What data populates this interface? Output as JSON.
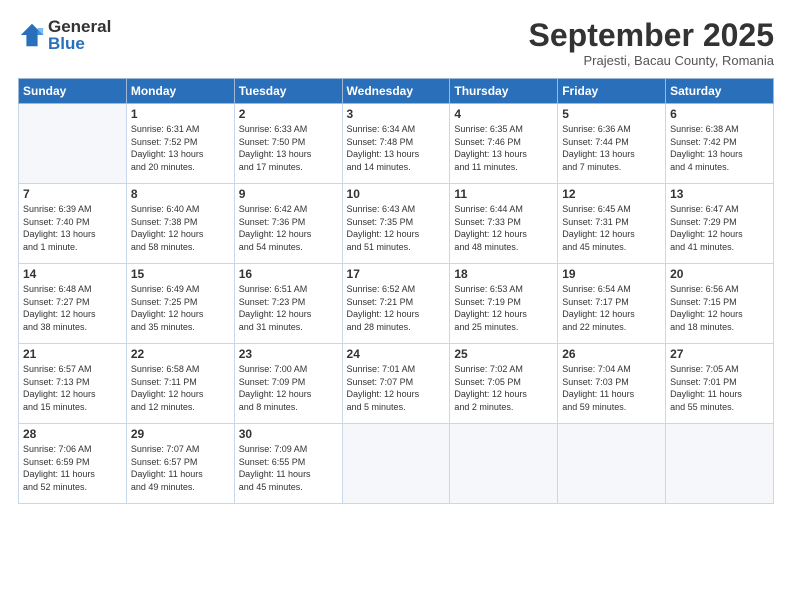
{
  "header": {
    "logo_general": "General",
    "logo_blue": "Blue",
    "month_title": "September 2025",
    "location": "Prajesti, Bacau County, Romania"
  },
  "weekdays": [
    "Sunday",
    "Monday",
    "Tuesday",
    "Wednesday",
    "Thursday",
    "Friday",
    "Saturday"
  ],
  "weeks": [
    [
      {
        "day": "",
        "info": ""
      },
      {
        "day": "1",
        "info": "Sunrise: 6:31 AM\nSunset: 7:52 PM\nDaylight: 13 hours\nand 20 minutes."
      },
      {
        "day": "2",
        "info": "Sunrise: 6:33 AM\nSunset: 7:50 PM\nDaylight: 13 hours\nand 17 minutes."
      },
      {
        "day": "3",
        "info": "Sunrise: 6:34 AM\nSunset: 7:48 PM\nDaylight: 13 hours\nand 14 minutes."
      },
      {
        "day": "4",
        "info": "Sunrise: 6:35 AM\nSunset: 7:46 PM\nDaylight: 13 hours\nand 11 minutes."
      },
      {
        "day": "5",
        "info": "Sunrise: 6:36 AM\nSunset: 7:44 PM\nDaylight: 13 hours\nand 7 minutes."
      },
      {
        "day": "6",
        "info": "Sunrise: 6:38 AM\nSunset: 7:42 PM\nDaylight: 13 hours\nand 4 minutes."
      }
    ],
    [
      {
        "day": "7",
        "info": "Sunrise: 6:39 AM\nSunset: 7:40 PM\nDaylight: 13 hours\nand 1 minute."
      },
      {
        "day": "8",
        "info": "Sunrise: 6:40 AM\nSunset: 7:38 PM\nDaylight: 12 hours\nand 58 minutes."
      },
      {
        "day": "9",
        "info": "Sunrise: 6:42 AM\nSunset: 7:36 PM\nDaylight: 12 hours\nand 54 minutes."
      },
      {
        "day": "10",
        "info": "Sunrise: 6:43 AM\nSunset: 7:35 PM\nDaylight: 12 hours\nand 51 minutes."
      },
      {
        "day": "11",
        "info": "Sunrise: 6:44 AM\nSunset: 7:33 PM\nDaylight: 12 hours\nand 48 minutes."
      },
      {
        "day": "12",
        "info": "Sunrise: 6:45 AM\nSunset: 7:31 PM\nDaylight: 12 hours\nand 45 minutes."
      },
      {
        "day": "13",
        "info": "Sunrise: 6:47 AM\nSunset: 7:29 PM\nDaylight: 12 hours\nand 41 minutes."
      }
    ],
    [
      {
        "day": "14",
        "info": "Sunrise: 6:48 AM\nSunset: 7:27 PM\nDaylight: 12 hours\nand 38 minutes."
      },
      {
        "day": "15",
        "info": "Sunrise: 6:49 AM\nSunset: 7:25 PM\nDaylight: 12 hours\nand 35 minutes."
      },
      {
        "day": "16",
        "info": "Sunrise: 6:51 AM\nSunset: 7:23 PM\nDaylight: 12 hours\nand 31 minutes."
      },
      {
        "day": "17",
        "info": "Sunrise: 6:52 AM\nSunset: 7:21 PM\nDaylight: 12 hours\nand 28 minutes."
      },
      {
        "day": "18",
        "info": "Sunrise: 6:53 AM\nSunset: 7:19 PM\nDaylight: 12 hours\nand 25 minutes."
      },
      {
        "day": "19",
        "info": "Sunrise: 6:54 AM\nSunset: 7:17 PM\nDaylight: 12 hours\nand 22 minutes."
      },
      {
        "day": "20",
        "info": "Sunrise: 6:56 AM\nSunset: 7:15 PM\nDaylight: 12 hours\nand 18 minutes."
      }
    ],
    [
      {
        "day": "21",
        "info": "Sunrise: 6:57 AM\nSunset: 7:13 PM\nDaylight: 12 hours\nand 15 minutes."
      },
      {
        "day": "22",
        "info": "Sunrise: 6:58 AM\nSunset: 7:11 PM\nDaylight: 12 hours\nand 12 minutes."
      },
      {
        "day": "23",
        "info": "Sunrise: 7:00 AM\nSunset: 7:09 PM\nDaylight: 12 hours\nand 8 minutes."
      },
      {
        "day": "24",
        "info": "Sunrise: 7:01 AM\nSunset: 7:07 PM\nDaylight: 12 hours\nand 5 minutes."
      },
      {
        "day": "25",
        "info": "Sunrise: 7:02 AM\nSunset: 7:05 PM\nDaylight: 12 hours\nand 2 minutes."
      },
      {
        "day": "26",
        "info": "Sunrise: 7:04 AM\nSunset: 7:03 PM\nDaylight: 11 hours\nand 59 minutes."
      },
      {
        "day": "27",
        "info": "Sunrise: 7:05 AM\nSunset: 7:01 PM\nDaylight: 11 hours\nand 55 minutes."
      }
    ],
    [
      {
        "day": "28",
        "info": "Sunrise: 7:06 AM\nSunset: 6:59 PM\nDaylight: 11 hours\nand 52 minutes."
      },
      {
        "day": "29",
        "info": "Sunrise: 7:07 AM\nSunset: 6:57 PM\nDaylight: 11 hours\nand 49 minutes."
      },
      {
        "day": "30",
        "info": "Sunrise: 7:09 AM\nSunset: 6:55 PM\nDaylight: 11 hours\nand 45 minutes."
      },
      {
        "day": "",
        "info": ""
      },
      {
        "day": "",
        "info": ""
      },
      {
        "day": "",
        "info": ""
      },
      {
        "day": "",
        "info": ""
      }
    ]
  ]
}
